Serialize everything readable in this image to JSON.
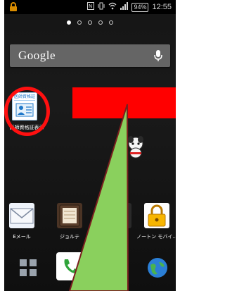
{
  "status_bar": {
    "battery": "94%",
    "time": "12:55",
    "icons": [
      "nfc-icon",
      "vibrate-icon",
      "wifi-icon",
      "signal-icon"
    ]
  },
  "home": {
    "page_dots_count": 5,
    "active_dot": 0,
    "search": {
      "brand": "Google",
      "mic_icon": "mic-icon"
    },
    "highlighted_app": {
      "icon_title": "医師資格証",
      "label": "医師資格証表示"
    },
    "dock_apps": [
      {
        "label": "Eメール",
        "icon": "mail-icon"
      },
      {
        "label": "ジョルテ",
        "icon": "planner-icon"
      },
      {
        "label": "",
        "icon": "hidden-app-icon"
      },
      {
        "label": "ノートン モバイ..",
        "icon": "lock-icon"
      }
    ],
    "tray": [
      {
        "icon": "apps-grid-icon"
      },
      {
        "icon": "phone-icon"
      },
      {
        "icon": "browser-globe-icon"
      }
    ]
  },
  "annotations": {
    "circle_color": "#ff1010",
    "redaction_color": "#ff0000",
    "arrow_fill": "#8ad05d",
    "arrow_stroke": "#7a1f1f"
  }
}
